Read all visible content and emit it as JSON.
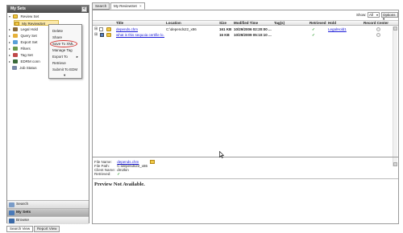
{
  "left_panel": {
    "title": "My Sets",
    "tree": [
      {
        "label": "Review Set",
        "icon": "folder-icon",
        "toggle": "▾"
      },
      {
        "label": "My ReviewSet",
        "icon": "folder-icon",
        "toggle": ""
      },
      {
        "label": "Legal Hold",
        "icon": "gavel-icon",
        "toggle": "▸"
      },
      {
        "label": "Query Set",
        "icon": "query-icon",
        "toggle": "▸"
      },
      {
        "label": "Export Set",
        "icon": "export-icon",
        "toggle": "▸"
      },
      {
        "label": "Filters",
        "icon": "filter-icon",
        "toggle": "▸"
      },
      {
        "label": "Tag Set",
        "icon": "tag-icon",
        "toggle": "▸"
      },
      {
        "label": "EDRM conn",
        "icon": "connector-icon",
        "toggle": "▸"
      },
      {
        "label": "Job Status",
        "icon": "job-status-icon",
        "toggle": ""
      }
    ],
    "nav": [
      {
        "label": "Search",
        "icon": "search-icon"
      },
      {
        "label": "My Sets",
        "icon": "sets-icon"
      },
      {
        "label": "Browse",
        "icon": "browse-icon"
      }
    ]
  },
  "context_menu": {
    "items": [
      "Delete",
      "Share",
      "Save To XML",
      "Manage Tag",
      "Export To",
      "Retrieve",
      "Submit To EDM"
    ],
    "submenu_arrow": "▸",
    "more_arrow": "▾",
    "highlight_color": "#d0312d"
  },
  "tabs": [
    {
      "label": "Search"
    },
    {
      "label": "My ReviewSet",
      "close": "×"
    }
  ],
  "toolbar": {
    "show_label": "Show:",
    "show_value": "All",
    "options_label": "Options ▾"
  },
  "grid": {
    "columns": [
      "Title",
      "Location",
      "Size",
      "Modified Time",
      "Tag(s)",
      "Retrieved",
      "Hold",
      "Record Center"
    ],
    "rows": [
      {
        "title": "depends.chm",
        "location": "C:\\depends22_x86",
        "size": "161 KB",
        "modified": "10/29/2006 02:20:00 ...",
        "tags": "",
        "retrieved": "✓",
        "hold": "LegalHold1",
        "record": ""
      },
      {
        "title": "what is this sequoia certifie lo...",
        "location": "",
        "size": "16 KB",
        "modified": "10/29/2009 05:10:10 ...",
        "tags": "",
        "retrieved": "✓",
        "hold": "",
        "record": ""
      }
    ]
  },
  "preview": {
    "fields": [
      {
        "label": "File Name:",
        "value": "depends.chm",
        "link": true
      },
      {
        "label": "File Path:",
        "value": "C:\\depends22_x86",
        "link": false
      },
      {
        "label": "Client Name:",
        "value": "dm2kin",
        "link": false
      },
      {
        "label": "Retrieved:",
        "value": "✓",
        "link": false
      }
    ],
    "message": "Preview Not Available."
  },
  "bottom_tabs": [
    {
      "label": "Search View"
    },
    {
      "label": "Report View"
    }
  ],
  "colors": {
    "header_dark": "#4a4a4a",
    "selection": "#fce9a8",
    "link": "#1a1ad8",
    "check": "#2a9a2a"
  }
}
